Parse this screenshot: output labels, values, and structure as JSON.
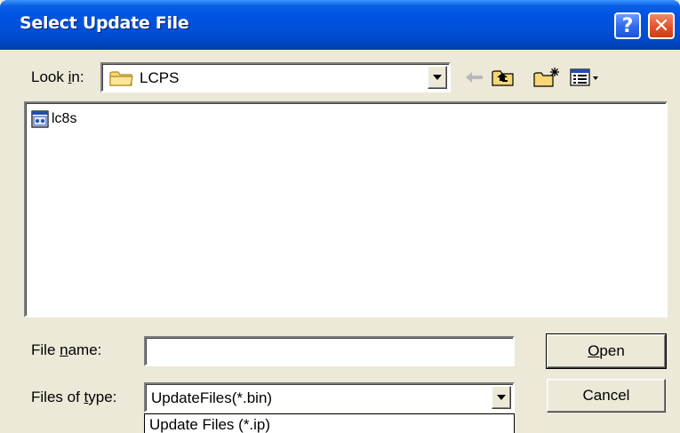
{
  "window": {
    "title": "Select Update File",
    "help_glyph": "?",
    "close_glyph": "✕"
  },
  "lookin": {
    "label_prefix": "Look ",
    "label_accel": "i",
    "label_suffix": "n:",
    "value": "LCPS"
  },
  "files": [
    {
      "name": "lc8s",
      "icon": "dll-file-icon"
    }
  ],
  "filename": {
    "label_prefix": "File ",
    "label_accel": "n",
    "label_suffix": "ame:",
    "value": ""
  },
  "filetype": {
    "label_prefix": "Files of ",
    "label_accel": "t",
    "label_suffix": "ype:",
    "value": "UpdateFiles(*.bin)",
    "dropdown_option": "Update Files (*.ip)"
  },
  "buttons": {
    "open_accel": "O",
    "open_rest": "pen",
    "cancel": "Cancel"
  },
  "colors": {
    "titlebar": "#0054e3",
    "dialog_bg": "#ece9d8",
    "close_button": "#e2532c"
  }
}
